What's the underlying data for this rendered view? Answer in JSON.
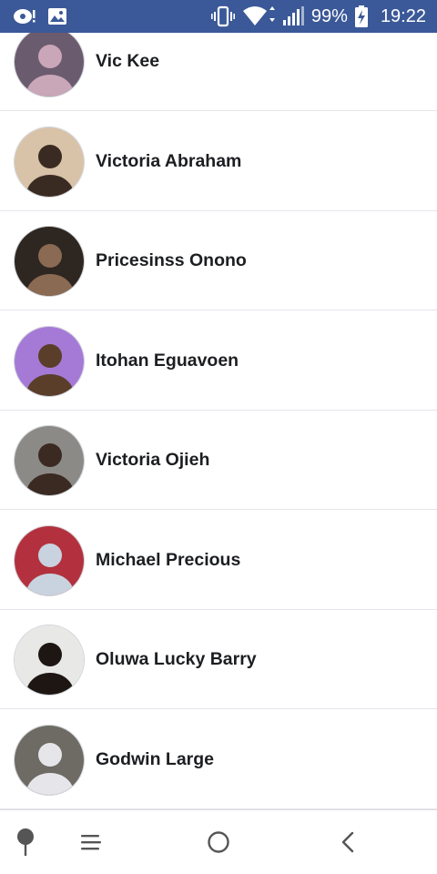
{
  "status_bar": {
    "battery_percent": "99%",
    "time": "19:22",
    "icons": [
      "notification-icon",
      "gallery-icon",
      "vibrate-icon",
      "wifi-icon",
      "signal-icon",
      "battery-charging-icon"
    ]
  },
  "friends": [
    {
      "name": "Vic Kee",
      "avatar_colors": [
        "#6b5b6e",
        "#c9a6b8"
      ]
    },
    {
      "name": "Victoria Abraham",
      "avatar_colors": [
        "#d8c2a8",
        "#3a2b22"
      ]
    },
    {
      "name": "Pricesinss Onono",
      "avatar_colors": [
        "#2e2620",
        "#8a6a52"
      ]
    },
    {
      "name": "Itohan Eguavoen",
      "avatar_colors": [
        "#a57ad6",
        "#5a3e2a"
      ]
    },
    {
      "name": "Victoria Ojieh",
      "avatar_colors": [
        "#8c8a86",
        "#3b2a22"
      ]
    },
    {
      "name": "Michael Precious",
      "avatar_colors": [
        "#b3313e",
        "#c9d3e0"
      ]
    },
    {
      "name": "Oluwa Lucky Barry",
      "avatar_colors": [
        "#e8e8e6",
        "#1e1612"
      ]
    },
    {
      "name": "Godwin Large",
      "avatar_colors": [
        "#6e6a64",
        "#e6e6ea"
      ]
    }
  ],
  "nav_bar": {
    "icons": [
      "pin-icon",
      "menu-icon",
      "home-icon",
      "back-icon"
    ]
  },
  "colors": {
    "status_bar_bg": "#3b5998",
    "name_text": "#1c1e21",
    "divider": "#e4e6eb"
  }
}
